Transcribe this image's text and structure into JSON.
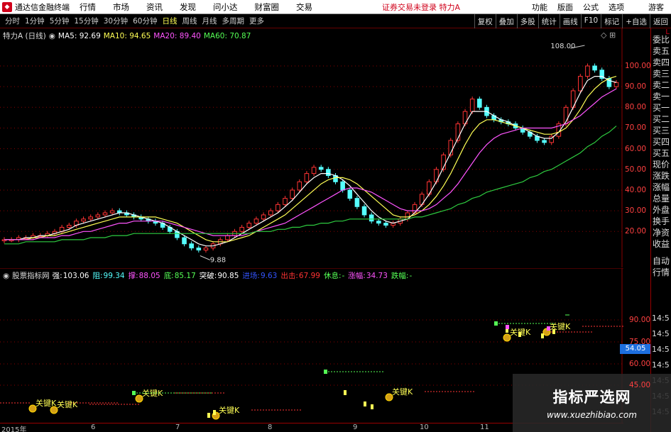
{
  "menubar": {
    "app_title": "通达信金融终端",
    "menus": [
      "行情",
      "市场",
      "资讯",
      "发现",
      "问小达",
      "财富圈",
      "交易"
    ],
    "notice": "证券交易未登录 特力A",
    "right_items": [
      "功能",
      "版面",
      "公式",
      "选项"
    ],
    "guest": "游客"
  },
  "toolbar": {
    "periods": [
      "分时",
      "1分钟",
      "5分钟",
      "15分钟",
      "30分钟",
      "60分钟",
      "日线",
      "周线",
      "月线",
      "多周期",
      "更多"
    ],
    "active_period": "日线",
    "right_buttons": [
      "复权",
      "叠加",
      "多股",
      "统计",
      "画线",
      "F10",
      "标记",
      "+自选",
      "返回"
    ]
  },
  "main_legend": {
    "title": "特力A (日线)",
    "ma5": "MA5: 92.69",
    "ma10": "MA10: 94.65",
    "ma20": "MA20: 89.40",
    "ma60": "MA60: 70.87",
    "colors": {
      "ma5": "#ffffff",
      "ma10": "#ffff55",
      "ma20": "#ff55ff",
      "ma60": "#55ff55"
    }
  },
  "indicator_legend": {
    "title": "股票指标网",
    "items": [
      {
        "label": "强:",
        "value": "103.06",
        "color": "#ffffff"
      },
      {
        "label": "阻:",
        "value": "99.34",
        "color": "#55ffff"
      },
      {
        "label": "撑:",
        "value": "88.05",
        "color": "#ff55ff"
      },
      {
        "label": "底:",
        "value": "85.17",
        "color": "#55ff55"
      },
      {
        "label": "突破:",
        "value": "90.85",
        "color": "#ffffff"
      },
      {
        "label": "进场:",
        "value": "9.63",
        "color": "#3355ff"
      },
      {
        "label": "出击:",
        "value": "67.99",
        "color": "#ff3333"
      },
      {
        "label": "休息:",
        "value": "-",
        "color": "#55ff55"
      },
      {
        "label": "涨幅:",
        "value": "34.73",
        "color": "#ff55ff"
      },
      {
        "label": "跌幅:",
        "value": "-",
        "color": "#55ff55"
      }
    ]
  },
  "price_axis": [
    "100.00",
    "90.00",
    "80.00",
    "70.00",
    "60.00",
    "50.00",
    "40.00",
    "30.00",
    "20.00"
  ],
  "indicator_axis": [
    "90.00",
    "75.00",
    "60.00",
    "45.00"
  ],
  "price_marker": "54.05",
  "annotations": {
    "high": "108.00",
    "low": "9.88",
    "key_k": "关键K"
  },
  "dates": [
    "2015年",
    "6",
    "7",
    "8",
    "9",
    "10",
    "11"
  ],
  "right_panel": [
    "委比",
    "卖五",
    "卖四",
    "卖三",
    "卖二",
    "卖一",
    "买一",
    "买二",
    "买三",
    "买四",
    "买五",
    "现价",
    "涨跌",
    "涨幅",
    "总量",
    "外盘",
    "换手",
    "净资",
    "收益",
    "自动",
    "行情"
  ],
  "right_panel_top": "L",
  "time_cells": [
    "14:5",
    "14:5",
    "14:5",
    "14:5",
    "14:5",
    "14:5",
    "14:5"
  ],
  "watermark": {
    "title": "指标严选网",
    "url": "www.xuezhibiao.com"
  },
  "colors": {
    "up": "#ff3333",
    "down": "#55ffff",
    "grid": "#8b0000",
    "ma60": "#2ecc40"
  },
  "chart_data": {
    "type": "candlestick",
    "title": "特力A (日线)",
    "ylim": [
      5,
      112
    ],
    "x": [
      "2015-05",
      "2015-06",
      "2015-07",
      "2015-08",
      "2015-09",
      "2015-10",
      "2015-11"
    ],
    "close": [
      16,
      16,
      17,
      17,
      18,
      18,
      19,
      20,
      22,
      23,
      25,
      26,
      27,
      28,
      29,
      30,
      29,
      28,
      27,
      26,
      25,
      24,
      22,
      20,
      17,
      14,
      12,
      11,
      12,
      14,
      16,
      18,
      20,
      22,
      24,
      26,
      28,
      30,
      33,
      36,
      40,
      44,
      48,
      51,
      50,
      47,
      44,
      40,
      36,
      32,
      28,
      25,
      24,
      23,
      24,
      26,
      29,
      33,
      38,
      44,
      50,
      57,
      64,
      72,
      78,
      84,
      80,
      76,
      74,
      73,
      72,
      70,
      68,
      66,
      64,
      63,
      66,
      72,
      80,
      88,
      95,
      100,
      98,
      94,
      90,
      92
    ],
    "series": [
      {
        "name": "MA5",
        "values": [
          16,
          16,
          16,
          17,
          17,
          18,
          18,
          19,
          20,
          21,
          23,
          24,
          25,
          26,
          27,
          28,
          29,
          29,
          28,
          27,
          26,
          25,
          24,
          22,
          20,
          18,
          16,
          14,
          13,
          13,
          14,
          15,
          17,
          19,
          21,
          23,
          25,
          27,
          29,
          32,
          35,
          39,
          43,
          46,
          48,
          48,
          47,
          45,
          42,
          38,
          34,
          30,
          27,
          25,
          24,
          25,
          26,
          29,
          33,
          38,
          44,
          51,
          58,
          65,
          72,
          78,
          78,
          78,
          76,
          74,
          73,
          71,
          70,
          68,
          66,
          65,
          65,
          68,
          73,
          80,
          87,
          93,
          95,
          95,
          93,
          92
        ]
      },
      {
        "name": "MA10",
        "values": [
          16,
          16,
          16,
          16,
          17,
          17,
          18,
          18,
          19,
          20,
          21,
          22,
          23,
          24,
          25,
          26,
          27,
          27,
          27,
          27,
          27,
          27,
          26,
          25,
          24,
          22,
          20,
          18,
          16,
          15,
          15,
          15,
          16,
          17,
          18,
          20,
          22,
          24,
          26,
          28,
          31,
          34,
          37,
          40,
          43,
          45,
          46,
          46,
          45,
          43,
          40,
          37,
          34,
          31,
          28,
          27,
          27,
          28,
          30,
          33,
          37,
          42,
          48,
          55,
          62,
          68,
          72,
          74,
          74,
          73,
          72,
          71,
          70,
          69,
          68,
          67,
          67,
          68,
          70,
          74,
          79,
          85,
          89,
          92,
          94,
          95
        ]
      },
      {
        "name": "MA20",
        "values": [
          16,
          16,
          16,
          16,
          16,
          17,
          17,
          17,
          18,
          18,
          19,
          20,
          20,
          21,
          22,
          23,
          24,
          24,
          25,
          25,
          25,
          25,
          25,
          24,
          23,
          22,
          21,
          20,
          19,
          18,
          18,
          18,
          18,
          18,
          19,
          20,
          21,
          22,
          23,
          24,
          26,
          28,
          30,
          32,
          34,
          36,
          38,
          40,
          41,
          41,
          40,
          39,
          37,
          35,
          33,
          31,
          30,
          30,
          30,
          31,
          33,
          36,
          39,
          43,
          48,
          53,
          58,
          62,
          65,
          67,
          68,
          69,
          70,
          70,
          70,
          70,
          70,
          71,
          72,
          74,
          76,
          79,
          82,
          85,
          87,
          89
        ]
      },
      {
        "name": "MA60",
        "values": [
          14,
          14,
          14,
          15,
          15,
          15,
          15,
          15,
          16,
          16,
          16,
          16,
          17,
          17,
          17,
          18,
          18,
          18,
          19,
          19,
          19,
          19,
          19,
          19,
          19,
          19,
          19,
          19,
          19,
          19,
          19,
          19,
          19,
          19,
          19,
          20,
          20,
          20,
          21,
          21,
          22,
          22,
          23,
          23,
          24,
          24,
          25,
          25,
          26,
          26,
          26,
          26,
          26,
          26,
          26,
          26,
          26,
          27,
          27,
          28,
          29,
          30,
          31,
          33,
          34,
          36,
          37,
          39,
          40,
          41,
          42,
          43,
          44,
          46,
          47,
          49,
          50,
          52,
          54,
          56,
          58,
          61,
          63,
          66,
          68,
          71
        ]
      }
    ]
  }
}
